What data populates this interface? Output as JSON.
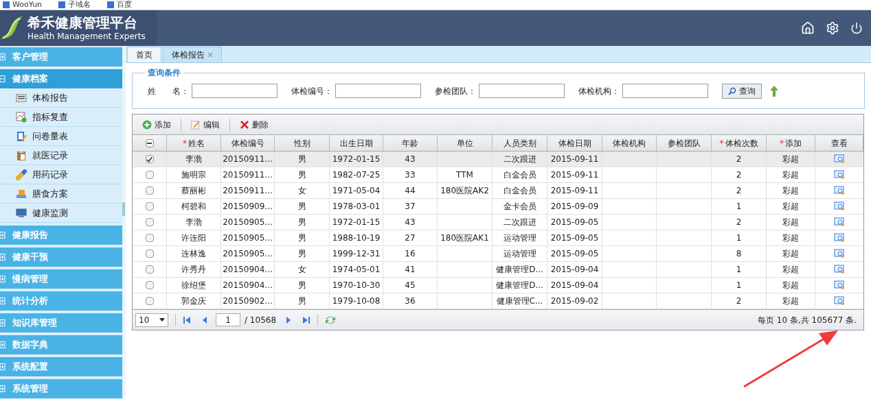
{
  "bookmarks": [
    "WooYun",
    "子域名",
    "百度"
  ],
  "header": {
    "title": "希禾健康管理平台",
    "subtitle": "Health Management Experts"
  },
  "sidebar": {
    "groups": [
      {
        "label": "客户管理",
        "expanded": false
      },
      {
        "label": "健康档案",
        "expanded": true,
        "items": [
          {
            "label": "体检报告",
            "kind": "report"
          },
          {
            "label": "指标复查",
            "kind": "chart"
          },
          {
            "label": "问卷量表",
            "kind": "form"
          },
          {
            "label": "就医记录",
            "kind": "clipboard"
          },
          {
            "label": "用药记录",
            "kind": "pill"
          },
          {
            "label": "膳食方案",
            "kind": "food"
          },
          {
            "label": "健康监测",
            "kind": "monitor"
          }
        ]
      },
      {
        "label": "健康报告",
        "expanded": false
      },
      {
        "label": "健康干预",
        "expanded": false
      },
      {
        "label": "慢病管理",
        "expanded": false
      },
      {
        "label": "统计分析",
        "expanded": false
      },
      {
        "label": "知识库管理",
        "expanded": false
      },
      {
        "label": "数据字典",
        "expanded": false
      },
      {
        "label": "系统配置",
        "expanded": false
      },
      {
        "label": "系统管理",
        "expanded": false
      }
    ]
  },
  "tabs": [
    {
      "label": "首页",
      "selected": false,
      "closable": false
    },
    {
      "label": "体检报告",
      "selected": true,
      "closable": true
    }
  ],
  "query": {
    "legend": "查询条件",
    "fields": [
      {
        "label": "姓　　名："
      },
      {
        "label": "体检编号："
      },
      {
        "label": "参检团队："
      },
      {
        "label": "体检机构："
      }
    ],
    "button": "查询"
  },
  "toolbar": [
    {
      "label": "添加",
      "kind": "add"
    },
    {
      "label": "编辑",
      "kind": "edit"
    },
    {
      "label": "删除",
      "kind": "delete"
    }
  ],
  "table": {
    "select_all": {
      "indeterminate": true
    },
    "columns": [
      {
        "label": "姓名",
        "mark": "*"
      },
      {
        "label": "体检编号"
      },
      {
        "label": "性别"
      },
      {
        "label": "出生日期"
      },
      {
        "label": "年龄"
      },
      {
        "label": "单位"
      },
      {
        "label": "人员类别"
      },
      {
        "label": "体检日期"
      },
      {
        "label": "体检机构"
      },
      {
        "label": "参检团队"
      },
      {
        "label": "体检次数",
        "mark": "*"
      },
      {
        "label": "添加",
        "mark": "*"
      },
      {
        "label": "查看"
      }
    ],
    "rows": [
      {
        "selected": true,
        "cells": [
          "李渤",
          "20150911...",
          "男",
          "1972-01-15",
          "43",
          "",
          "二次跟进",
          "2015-09-11",
          "",
          "",
          "2",
          "彩超"
        ]
      },
      {
        "selected": false,
        "cells": [
          "施明宗",
          "20150911...",
          "男",
          "1982-07-25",
          "33",
          "TTM",
          "白金会员",
          "2015-09-11",
          "",
          "",
          "2",
          "彩超"
        ]
      },
      {
        "selected": false,
        "cells": [
          "蔡丽彬",
          "20150911...",
          "女",
          "1971-05-04",
          "44",
          "180医院AK2",
          "白金会员",
          "2015-09-11",
          "",
          "",
          "2",
          "彩超"
        ]
      },
      {
        "selected": false,
        "cells": [
          "柯碧和",
          "20150909...",
          "男",
          "1978-03-01",
          "37",
          "",
          "金卡会员",
          "2015-09-09",
          "",
          "",
          "1",
          "彩超"
        ]
      },
      {
        "selected": false,
        "cells": [
          "李渤",
          "20150905...",
          "男",
          "1972-01-15",
          "43",
          "",
          "二次跟进",
          "2015-09-05",
          "",
          "",
          "2",
          "彩超"
        ]
      },
      {
        "selected": false,
        "cells": [
          "许连阳",
          "20150905...",
          "男",
          "1988-10-19",
          "27",
          "180医院AK1",
          "运动管理",
          "2015-09-05",
          "",
          "",
          "1",
          "彩超"
        ]
      },
      {
        "selected": false,
        "cells": [
          "连林逸",
          "20150905...",
          "男",
          "1999-12-31",
          "16",
          "",
          "运动管理",
          "2015-09-05",
          "",
          "",
          "8",
          "彩超"
        ]
      },
      {
        "selected": false,
        "cells": [
          "许秀丹",
          "20150904...",
          "女",
          "1974-05-01",
          "41",
          "",
          "健康管理D...",
          "2015-09-04",
          "",
          "",
          "1",
          "彩超"
        ]
      },
      {
        "selected": false,
        "cells": [
          "徐绍堡",
          "20150904...",
          "男",
          "1970-10-30",
          "45",
          "",
          "健康管理D...",
          "2015-09-04",
          "",
          "",
          "1",
          "彩超"
        ]
      },
      {
        "selected": false,
        "cells": [
          "郭金庆",
          "20150902...",
          "男",
          "1979-10-08",
          "36",
          "",
          "健康管理C...",
          "2015-09-02",
          "",
          "",
          "2",
          "彩超"
        ]
      }
    ]
  },
  "pager": {
    "page_size": "10",
    "page": "1",
    "total_pages": "/ 10568",
    "summary": "每页 10 条,共 105677 条."
  }
}
